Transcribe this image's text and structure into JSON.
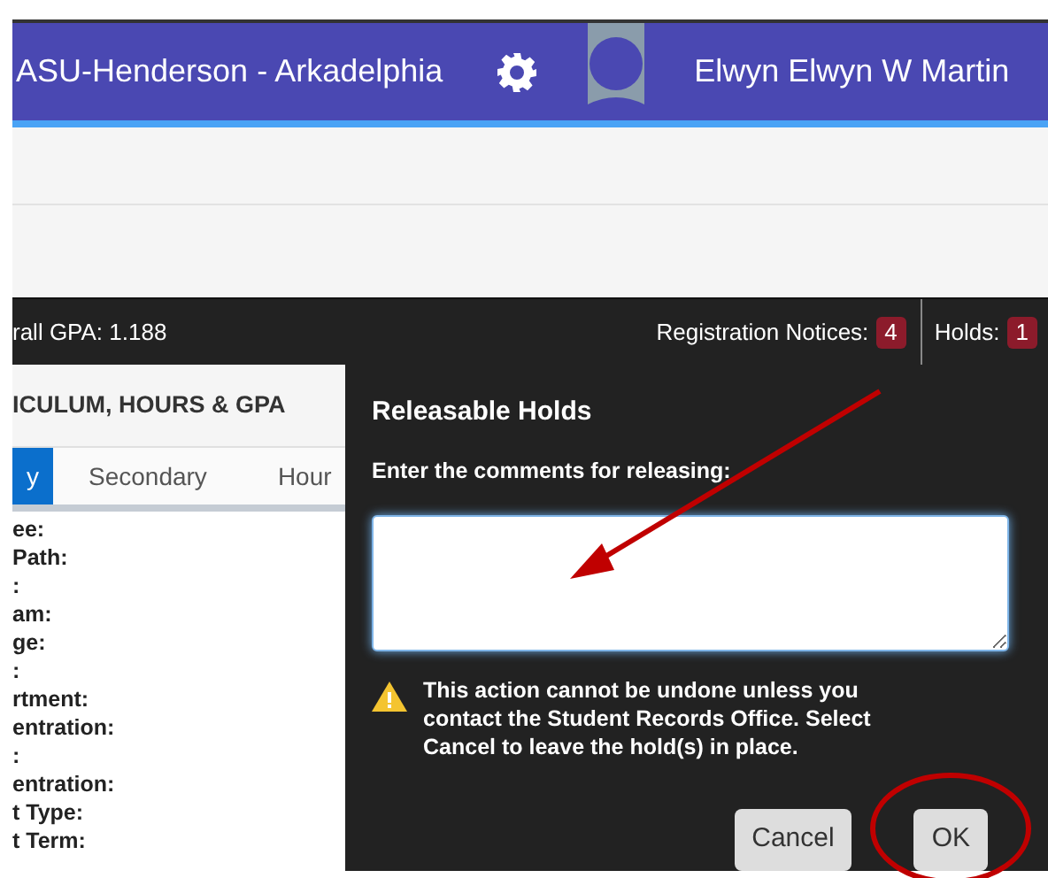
{
  "header": {
    "institution": "ASU-Henderson - Arkadelphia",
    "user_name": "Elwyn Elwyn W Martin"
  },
  "info_bar": {
    "gpa": "rall GPA: 1.188",
    "notices": [
      {
        "label": "Registration Notices:",
        "count": "4"
      },
      {
        "label": "Holds:",
        "count": "1"
      }
    ]
  },
  "panel": {
    "title": "ICULUM, HOURS & GPA",
    "tabs": [
      {
        "label": "y",
        "selected": true
      },
      {
        "label": "Secondary",
        "selected": false
      },
      {
        "label": "Hour",
        "selected": false
      }
    ],
    "fields": [
      "ee:",
      "Path:",
      ":",
      "am:",
      "ge:",
      ":",
      "rtment:",
      "entration:",
      ":",
      "entration:",
      "t Type:",
      "t Term:"
    ]
  },
  "dialog": {
    "title": "Releasable Holds",
    "prompt": "Enter the comments for releasing:",
    "warning": "This action cannot be undone unless you contact the Student Records Office. Select Cancel to leave the hold(s) in place.",
    "buttons": [
      "Cancel",
      "OK"
    ]
  }
}
